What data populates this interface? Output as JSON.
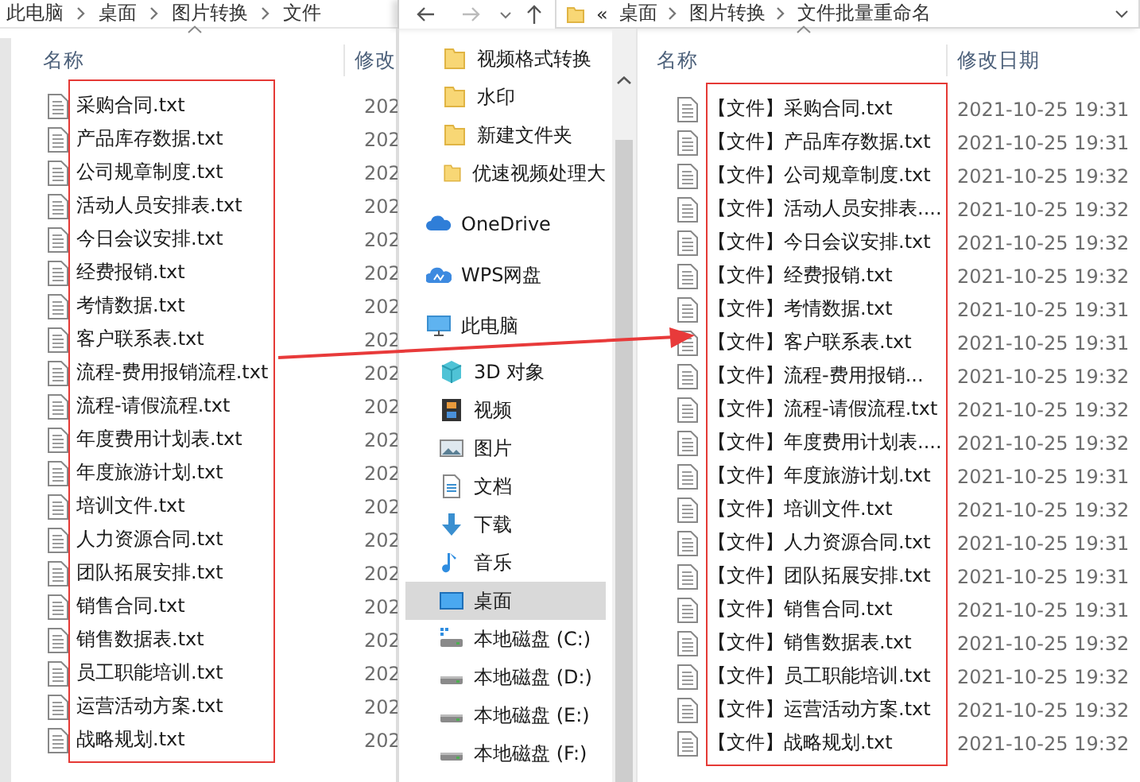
{
  "left_window": {
    "breadcrumb": [
      "此电脑",
      "桌面",
      "图片转换",
      "文件"
    ],
    "columns": [
      "名称",
      "修改"
    ],
    "files": [
      {
        "name": "采购合同.txt",
        "modified": "202"
      },
      {
        "name": "产品库存数据.txt",
        "modified": "202"
      },
      {
        "name": "公司规章制度.txt",
        "modified": "202"
      },
      {
        "name": "活动人员安排表.txt",
        "modified": "202"
      },
      {
        "name": "今日会议安排.txt",
        "modified": "202"
      },
      {
        "name": "经费报销.txt",
        "modified": "202"
      },
      {
        "name": "考情数据.txt",
        "modified": "202"
      },
      {
        "name": "客户联系表.txt",
        "modified": "202"
      },
      {
        "name": "流程-费用报销流程.txt",
        "modified": "202"
      },
      {
        "name": "流程-请假流程.txt",
        "modified": "202"
      },
      {
        "name": "年度费用计划表.txt",
        "modified": "202"
      },
      {
        "name": "年度旅游计划.txt",
        "modified": "202"
      },
      {
        "name": "培训文件.txt",
        "modified": "202"
      },
      {
        "name": "人力资源合同.txt",
        "modified": "202"
      },
      {
        "name": "团队拓展安排.txt",
        "modified": "202"
      },
      {
        "name": "销售合同.txt",
        "modified": "202"
      },
      {
        "name": "销售数据表.txt",
        "modified": "202"
      },
      {
        "name": "员工职能培训.txt",
        "modified": "202"
      },
      {
        "name": "运营活动方案.txt",
        "modified": "202"
      },
      {
        "name": "战略规划.txt",
        "modified": "202"
      }
    ]
  },
  "right_window": {
    "address": {
      "overflow": "«",
      "path": [
        "桌面",
        "图片转换",
        "文件批量重命名"
      ]
    },
    "nav_pane": {
      "items": [
        {
          "label": "视频格式转换",
          "kind": "folder",
          "selected": false
        },
        {
          "label": "水印",
          "kind": "folder",
          "selected": false
        },
        {
          "label": "新建文件夹",
          "kind": "folder",
          "selected": false
        },
        {
          "label": "优速视频处理大",
          "kind": "folder",
          "selected": false
        },
        {
          "label": "OneDrive",
          "kind": "cloud",
          "selected": false
        },
        {
          "label": "WPS网盘",
          "kind": "netdisk",
          "selected": false
        },
        {
          "label": "此电脑",
          "kind": "computer",
          "selected": false,
          "children": [
            {
              "label": "3D 对象",
              "kind": "cube",
              "selected": false
            },
            {
              "label": "视频",
              "kind": "video",
              "selected": false
            },
            {
              "label": "图片",
              "kind": "pictures",
              "selected": false
            },
            {
              "label": "文档",
              "kind": "documents",
              "selected": false
            },
            {
              "label": "下载",
              "kind": "downloads",
              "selected": false
            },
            {
              "label": "音乐",
              "kind": "music",
              "selected": false
            },
            {
              "label": "桌面",
              "kind": "desktop",
              "selected": true
            },
            {
              "label": "本地磁盘 (C:)",
              "kind": "system_drive",
              "selected": false
            },
            {
              "label": "本地磁盘 (D:)",
              "kind": "drive",
              "selected": false
            },
            {
              "label": "本地磁盘 (E:)",
              "kind": "drive",
              "selected": false
            },
            {
              "label": "本地磁盘 (F:)",
              "kind": "drive",
              "selected": false
            }
          ]
        }
      ]
    },
    "columns": [
      "名称",
      "修改日期"
    ],
    "files": [
      {
        "name": "【文件】采购合同.txt",
        "modified": "2021-10-25 19:31"
      },
      {
        "name": "【文件】产品库存数据.txt",
        "modified": "2021-10-25 19:31"
      },
      {
        "name": "【文件】公司规章制度.txt",
        "modified": "2021-10-25 19:32"
      },
      {
        "name": "【文件】活动人员安排表....",
        "modified": "2021-10-25 19:32"
      },
      {
        "name": "【文件】今日会议安排.txt",
        "modified": "2021-10-25 19:32"
      },
      {
        "name": "【文件】经费报销.txt",
        "modified": "2021-10-25 19:32"
      },
      {
        "name": "【文件】考情数据.txt",
        "modified": "2021-10-25 19:31"
      },
      {
        "name": "【文件】客户联系表.txt",
        "modified": "2021-10-25 19:31"
      },
      {
        "name": "【文件】流程-费用报销...",
        "modified": "2021-10-25 19:32"
      },
      {
        "name": "【文件】流程-请假流程.txt",
        "modified": "2021-10-25 19:32"
      },
      {
        "name": "【文件】年度费用计划表....",
        "modified": "2021-10-25 19:32"
      },
      {
        "name": "【文件】年度旅游计划.txt",
        "modified": "2021-10-25 19:31"
      },
      {
        "name": "【文件】培训文件.txt",
        "modified": "2021-10-25 19:32"
      },
      {
        "name": "【文件】人力资源合同.txt",
        "modified": "2021-10-25 19:31"
      },
      {
        "name": "【文件】团队拓展安排.txt",
        "modified": "2021-10-25 19:31"
      },
      {
        "name": "【文件】销售合同.txt",
        "modified": "2021-10-25 19:31"
      },
      {
        "name": "【文件】销售数据表.txt",
        "modified": "2021-10-25 19:32"
      },
      {
        "name": "【文件】员工职能培训.txt",
        "modified": "2021-10-25 19:32"
      },
      {
        "name": "【文件】运营活动方案.txt",
        "modified": "2021-10-25 19:32"
      },
      {
        "name": "【文件】战略规划.txt",
        "modified": "2021-10-25 19:32"
      }
    ]
  }
}
